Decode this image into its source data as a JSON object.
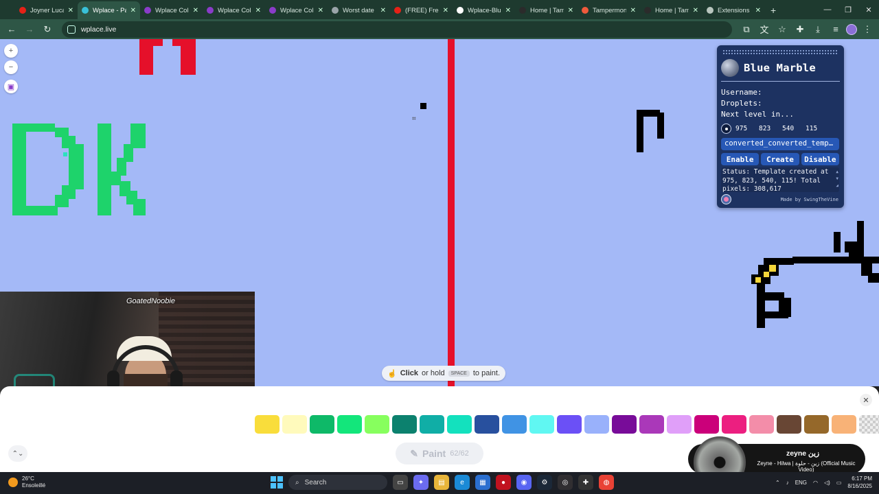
{
  "browser": {
    "tabs": [
      {
        "title": "Joyner Lucas",
        "color": "#e62117",
        "active": false
      },
      {
        "title": "Wplace - Paint the world",
        "color": "#39c0d8",
        "active": true
      },
      {
        "title": "Wplace Color",
        "color": "#8a3cc9",
        "active": false
      },
      {
        "title": "Wplace Color",
        "color": "#8a3cc9",
        "active": false
      },
      {
        "title": "Wplace Color",
        "color": "#8a3cc9",
        "active": false
      },
      {
        "title": "Worst date",
        "color": "#9aa4a9",
        "active": false
      },
      {
        "title": "(FREE) Freestyle",
        "color": "#e62117",
        "active": false
      },
      {
        "title": "Wplace-BlueMarble",
        "color": "#ffffff",
        "active": false
      },
      {
        "title": "Home | Tampermonkey",
        "color": "#2b2b2b",
        "active": false
      },
      {
        "title": "Tampermonkey",
        "color": "#ef5a3c",
        "active": false
      },
      {
        "title": "Home | Tampermonkey",
        "color": "#2b2b2b",
        "active": false
      },
      {
        "title": "Extensions",
        "color": "#b9c6bf",
        "active": false
      }
    ],
    "new_tab": "+",
    "url": "wplace.live",
    "window_controls": [
      "—",
      "❐",
      "✕"
    ]
  },
  "canvas": {
    "map_buttons": [
      "+",
      "−",
      "▣"
    ],
    "hint": {
      "click": "Click",
      "mid": "or hold",
      "key": "SPACE",
      "end": "to paint."
    }
  },
  "blue_marble": {
    "title": "Blue Marble",
    "username_label": "Username:",
    "droplets_label": "Droplets:",
    "next_level_label": "Next level in...",
    "coords": [
      "975",
      "823",
      "540",
      "115"
    ],
    "template_file": "converted_converted_template.png",
    "buttons": {
      "enable": "Enable",
      "create": "Create",
      "disable": "Disable"
    },
    "status": "Status: Template created at 975, 823, 540, 115! Total pixels: 308,617",
    "credit": "Made by SwingTheVine"
  },
  "webcam": {
    "handle": "GoatedNoobie"
  },
  "palette": {
    "colors": [
      "#f9dd3b",
      "#fffabc",
      "#0eb968",
      "#13e67b",
      "#87ff5e",
      "#0c816e",
      "#10aea6",
      "#13e1be",
      "#28509e",
      "#4093e4",
      "#60f7f2",
      "#6b50f6",
      "#99b1fb",
      "#780c99",
      "#aa38b9",
      "#e09ff9",
      "#cb007a",
      "#ec1f80",
      "#f38da9",
      "#684634",
      "#95682a",
      "#f8b277",
      "transparent"
    ],
    "paint_label": "Paint",
    "paint_count": "62/62",
    "close": "✕",
    "expand": "⌃⌄"
  },
  "music": {
    "title": "zeyne زين",
    "subtitle": "Zeyne - Hilwa | زين - حلوة (Official Music Video)"
  },
  "taskbar": {
    "temp": "26°C",
    "condition": "Ensoleillé",
    "search_placeholder": "Search",
    "lang": "ENG",
    "time": "6:17 PM",
    "date": "8/16/2025"
  }
}
